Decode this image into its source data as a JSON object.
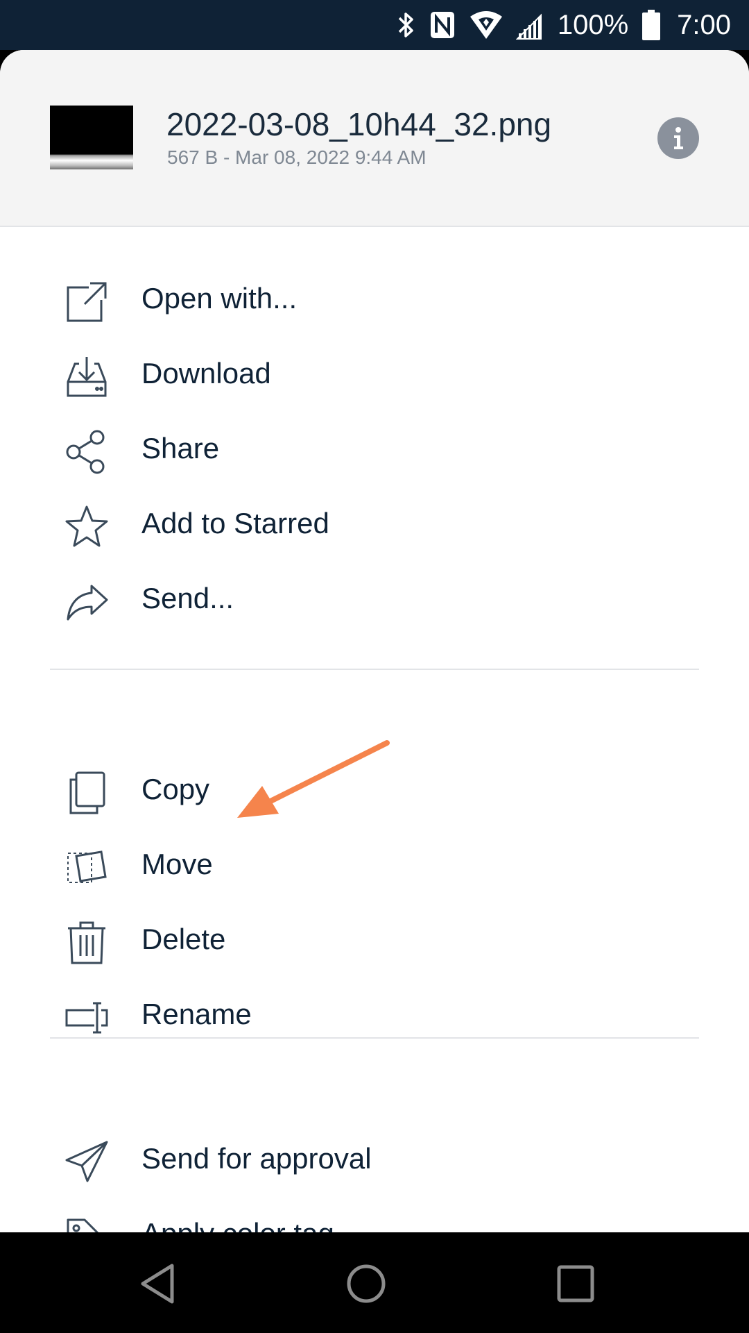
{
  "status_bar": {
    "battery_label": "100%",
    "time": "7:00",
    "icons": [
      "bluetooth-icon",
      "nfc-icon",
      "wifi-icon",
      "signal-icon",
      "battery-icon"
    ]
  },
  "file": {
    "name": "2022-03-08_10h44_32.png",
    "meta": "567 B - Mar 08, 2022 9:44 AM"
  },
  "menu": {
    "group1": [
      {
        "label": "Open with...",
        "icon": "open-external-icon"
      },
      {
        "label": "Download",
        "icon": "download-icon"
      },
      {
        "label": "Share",
        "icon": "share-icon"
      },
      {
        "label": "Add to Starred",
        "icon": "star-icon"
      },
      {
        "label": "Send...",
        "icon": "forward-icon"
      }
    ],
    "group2": [
      {
        "label": "Copy",
        "icon": "copy-icon"
      },
      {
        "label": "Move",
        "icon": "move-icon"
      },
      {
        "label": "Delete",
        "icon": "trash-icon"
      },
      {
        "label": "Rename",
        "icon": "rename-icon"
      }
    ],
    "group3": [
      {
        "label": "Send for approval",
        "icon": "paper-plane-icon"
      },
      {
        "label": "Apply color tag",
        "icon": "tag-icon"
      }
    ]
  },
  "colors": {
    "status_bar": "#0f2236",
    "text": "#0f2236",
    "meta_text": "#7f8893",
    "annotation_arrow": "#f5844c"
  }
}
